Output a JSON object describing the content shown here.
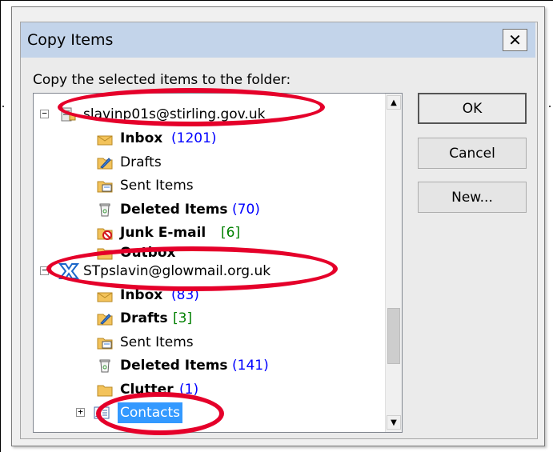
{
  "dialog": {
    "title": "Copy Items",
    "close_label": "✕",
    "prompt": "Copy the selected items to the folder:"
  },
  "tree": {
    "account1": {
      "name": "slavinp01s@stirling.gov.uk"
    },
    "a1_inbox": {
      "label": "Inbox",
      "count": "(1201)"
    },
    "a1_drafts": {
      "label": "Drafts"
    },
    "a1_sent": {
      "label": "Sent Items"
    },
    "a1_deleted": {
      "label": "Deleted Items",
      "count": "(70)"
    },
    "a1_junk": {
      "label": "Junk E-mail",
      "count": "[6]"
    },
    "a1_outbox": {
      "label": "Outbox"
    },
    "account2": {
      "name": "STpslavin@glowmail.org.uk"
    },
    "a2_inbox": {
      "label": "Inbox",
      "count": "(83)"
    },
    "a2_drafts": {
      "label": "Drafts",
      "count": "[3]"
    },
    "a2_sent": {
      "label": "Sent Items"
    },
    "a2_deleted": {
      "label": "Deleted Items",
      "count": "(141)"
    },
    "a2_clutter": {
      "label": "Clutter",
      "count": "(1)"
    },
    "a2_contacts": {
      "label": "Contacts",
      "selected": true
    }
  },
  "buttons": {
    "ok": "OK",
    "cancel": "Cancel",
    "new": "New..."
  },
  "colors": {
    "titlebar": "#c3d4ea",
    "selection": "#3399ff",
    "count_blue": "#0000ff",
    "count_green": "#008000",
    "annotation_red": "#e5002a"
  },
  "icons": [
    "collapse-icon",
    "expand-icon",
    "mailbox-icon",
    "exchange-account-icon",
    "inbox-icon",
    "drafts-icon",
    "sent-items-icon",
    "deleted-items-icon",
    "junk-email-icon",
    "outbox-icon",
    "clutter-icon",
    "contacts-icon",
    "scroll-up-icon",
    "scroll-down-icon"
  ]
}
